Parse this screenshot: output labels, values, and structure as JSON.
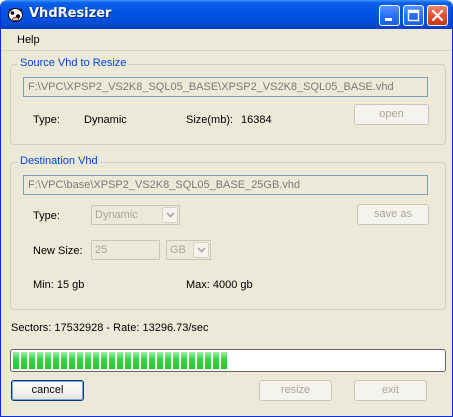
{
  "window": {
    "title": "VhdResizer"
  },
  "menu": {
    "items": [
      "Help"
    ]
  },
  "source": {
    "group_label": "Source Vhd to Resize",
    "path": "F:\\VPC\\XPSP2_VS2K8_SQL05_BASE\\XPSP2_VS2K8_SQL05_BASE.vhd",
    "type_label": "Type:",
    "type_value": "Dynamic",
    "size_label": "Size(mb):",
    "size_value": "16384",
    "open_button": "open"
  },
  "destination": {
    "group_label": "Destination Vhd",
    "path": "F:\\VPC\\base\\XPSP2_VS2K8_SQL05_BASE_25GB.vhd",
    "type_label": "Type:",
    "type_value": "Dynamic",
    "save_as_button": "save as",
    "new_size_label": "New Size:",
    "new_size_value": "25",
    "unit_value": "GB",
    "min_text": "Min: 15 gb",
    "max_text": "Max: 4000 gb"
  },
  "status": {
    "text": "Sectors: 17532928 - Rate: 13296.73/sec"
  },
  "progress": {
    "fraction": 0.49
  },
  "buttons": {
    "cancel": "cancel",
    "resize": "resize",
    "exit": "exit"
  },
  "colors": {
    "titlebar": "#0054e3",
    "group_label": "#0046d5",
    "progress_fill": "#2fd63b",
    "close_button": "#e2502b"
  },
  "icons": {
    "app": "cow-icon",
    "minimize": "minimize-icon",
    "maximize": "maximize-icon",
    "close": "close-icon",
    "dropdown": "chevron-down-icon"
  }
}
